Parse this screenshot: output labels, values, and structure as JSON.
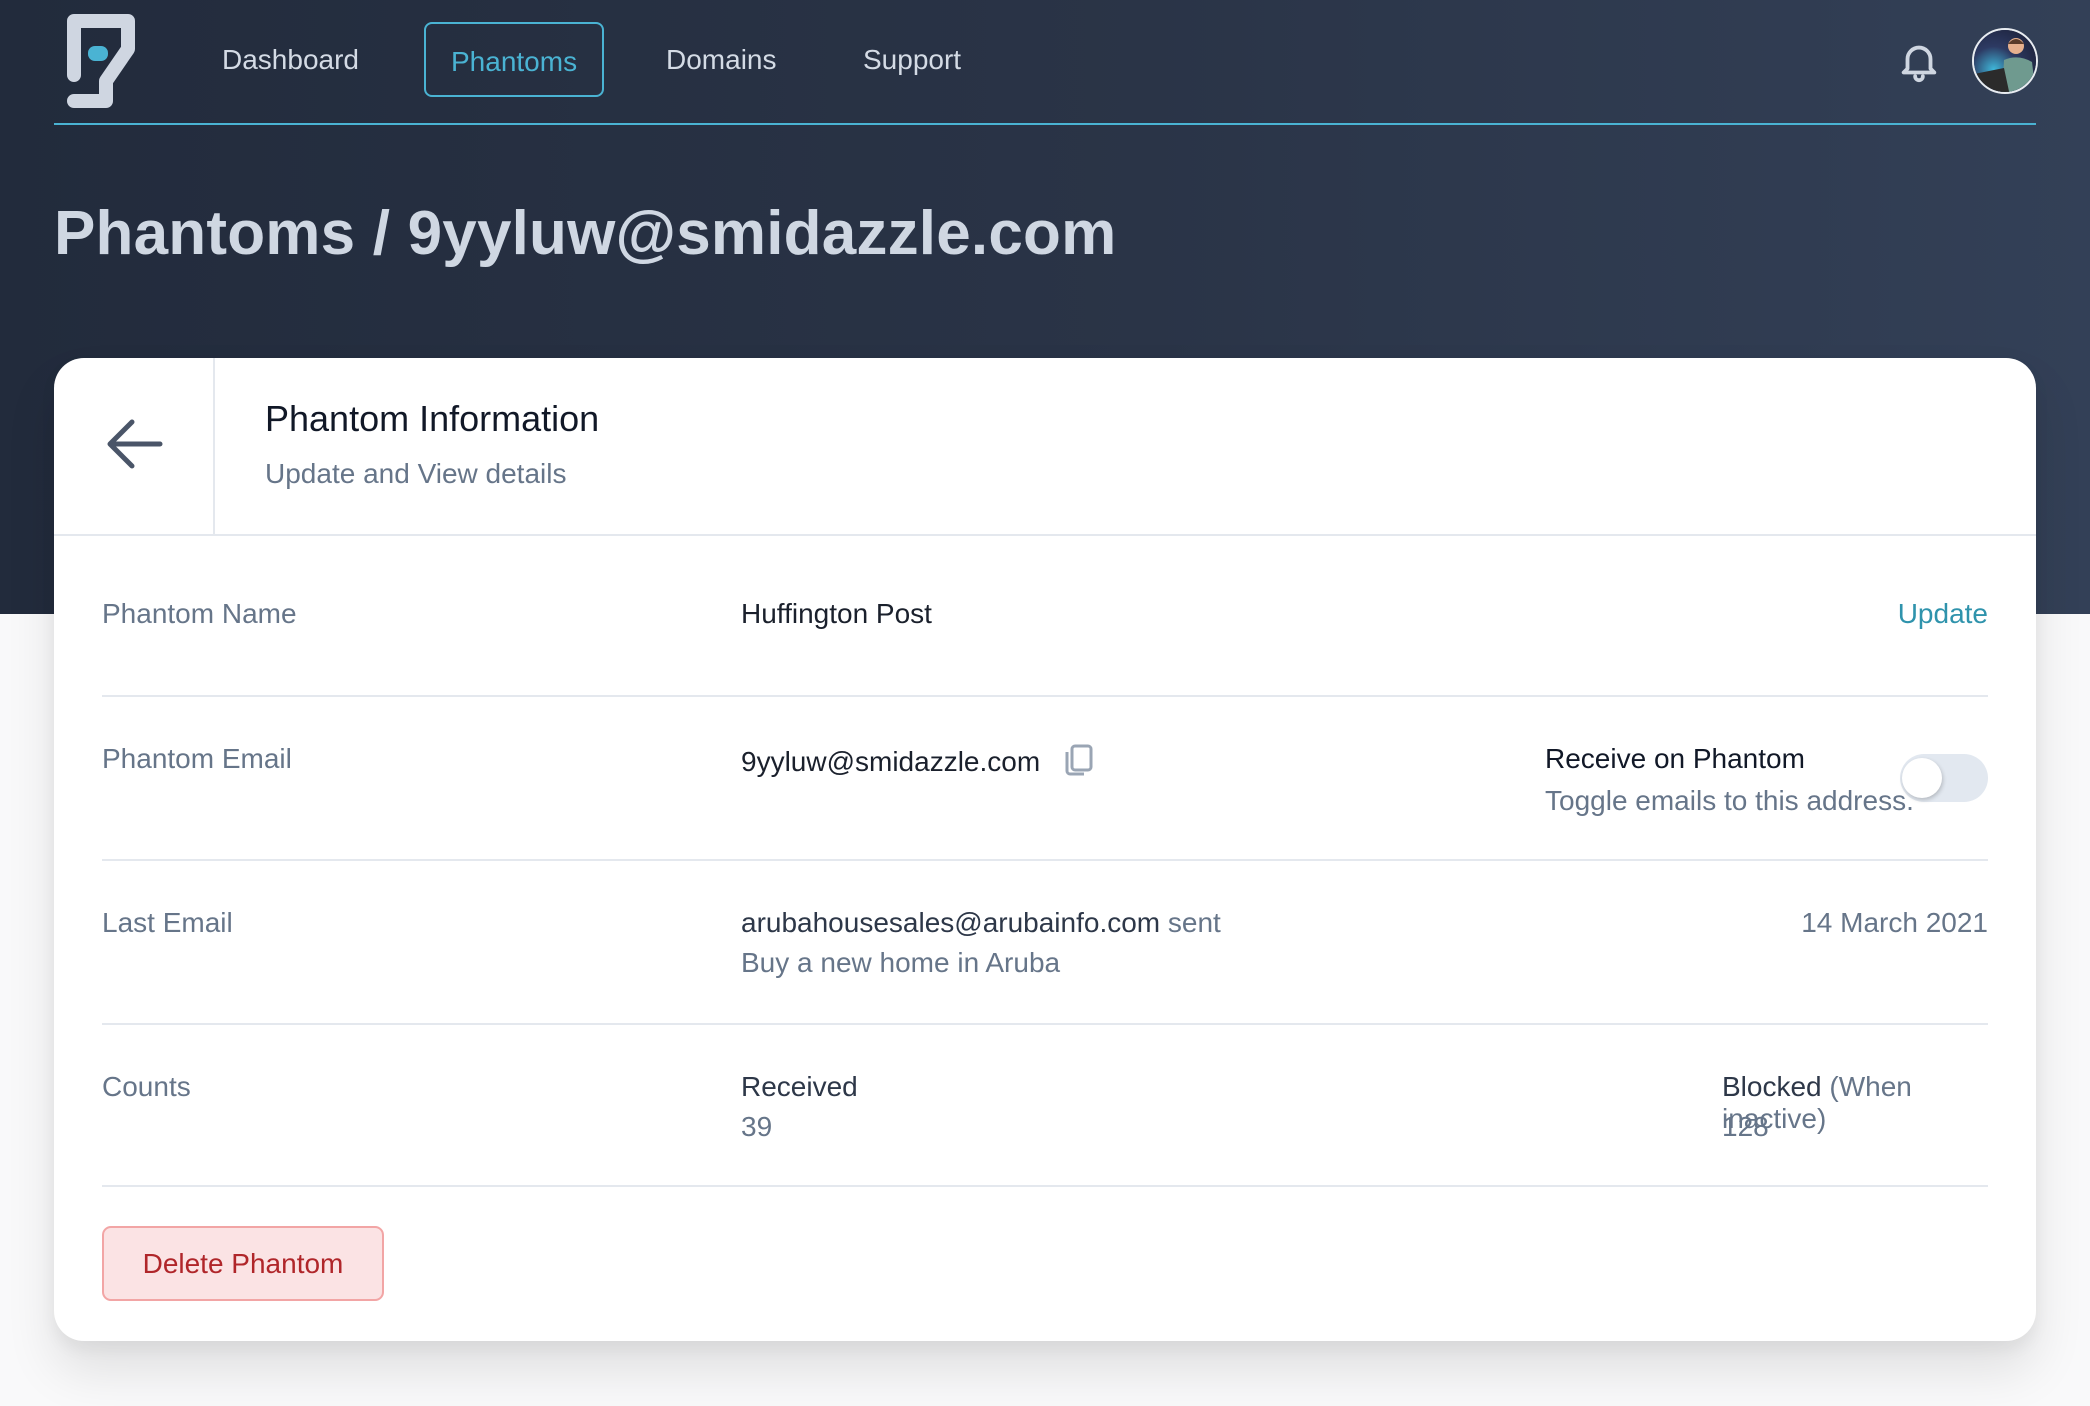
{
  "nav": {
    "logo": "phantom-logo",
    "items": [
      {
        "label": "Dashboard",
        "active": false
      },
      {
        "label": "Phantoms",
        "active": true
      },
      {
        "label": "Domains",
        "active": false
      },
      {
        "label": "Support",
        "active": false
      }
    ],
    "notification_icon": "bell-icon",
    "avatar": "user-avatar"
  },
  "page": {
    "title": "Phantoms / 9yyluw@smidazzle.com"
  },
  "card": {
    "back_icon": "arrow-left-icon",
    "title": "Phantom Information",
    "subtitle": "Update and View details",
    "rows": {
      "name": {
        "label": "Phantom Name",
        "value": "Huffington Post",
        "action": "Update"
      },
      "email": {
        "label": "Phantom Email",
        "value": "9yyluw@smidazzle.com",
        "copy_icon": "copy-icon",
        "toggle_title": "Receive on Phantom",
        "toggle_desc": "Toggle emails to this address.",
        "toggle_on": false
      },
      "last_email": {
        "label": "Last Email",
        "sender": "arubahousesales@arubainfo.com",
        "sent_word": "sent",
        "subject": "Buy a new home in Aruba",
        "date": "14 March 2021"
      },
      "counts": {
        "label": "Counts",
        "received_label": "Received",
        "received_value": "39",
        "blocked_label": "Blocked",
        "blocked_note": "(When inactive)",
        "blocked_value": "128"
      }
    },
    "delete_label": "Delete Phantom"
  },
  "colors": {
    "accent": "#4ab3d3",
    "link": "#2f93ac",
    "danger_text": "#b0262a",
    "danger_bg": "#fbe3e4",
    "header_bg": "#222b3c"
  }
}
